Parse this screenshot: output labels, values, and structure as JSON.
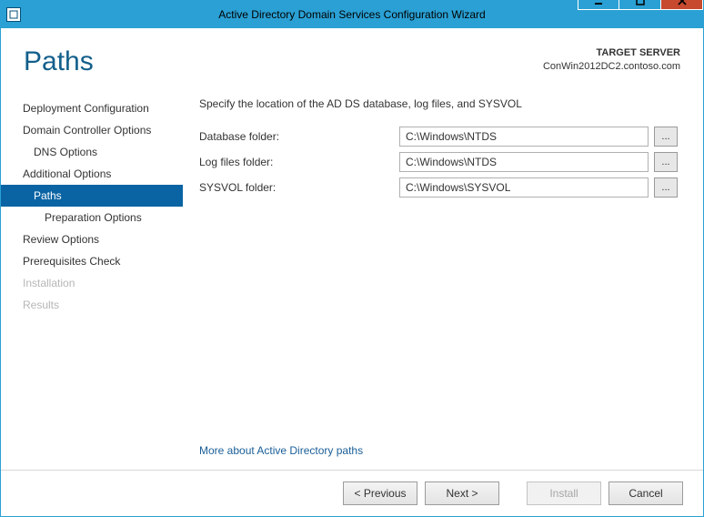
{
  "window": {
    "title": "Active Directory Domain Services Configuration Wizard"
  },
  "header": {
    "heading": "Paths",
    "target_label": "TARGET SERVER",
    "target_value": "ConWin2012DC2.contoso.com"
  },
  "sidebar": {
    "items": [
      {
        "label": "Deployment Configuration",
        "level": 0,
        "selected": false,
        "disabled": false
      },
      {
        "label": "Domain Controller Options",
        "level": 0,
        "selected": false,
        "disabled": false
      },
      {
        "label": "DNS Options",
        "level": 1,
        "selected": false,
        "disabled": false
      },
      {
        "label": "Additional Options",
        "level": 0,
        "selected": false,
        "disabled": false
      },
      {
        "label": "Paths",
        "level": 1,
        "selected": true,
        "disabled": false
      },
      {
        "label": "Preparation Options",
        "level": 2,
        "selected": false,
        "disabled": false
      },
      {
        "label": "Review Options",
        "level": 0,
        "selected": false,
        "disabled": false
      },
      {
        "label": "Prerequisites Check",
        "level": 0,
        "selected": false,
        "disabled": false
      },
      {
        "label": "Installation",
        "level": 0,
        "selected": false,
        "disabled": true
      },
      {
        "label": "Results",
        "level": 0,
        "selected": false,
        "disabled": true
      }
    ]
  },
  "content": {
    "instruction": "Specify the location of the AD DS database, log files, and SYSVOL",
    "rows": [
      {
        "label": "Database folder:",
        "value": "C:\\Windows\\NTDS"
      },
      {
        "label": "Log files folder:",
        "value": "C:\\Windows\\NTDS"
      },
      {
        "label": "SYSVOL folder:",
        "value": "C:\\Windows\\SYSVOL"
      }
    ],
    "browse_label": "...",
    "more_link": "More about Active Directory paths"
  },
  "footer": {
    "previous": "< Previous",
    "next": "Next >",
    "install": "Install",
    "cancel": "Cancel"
  }
}
